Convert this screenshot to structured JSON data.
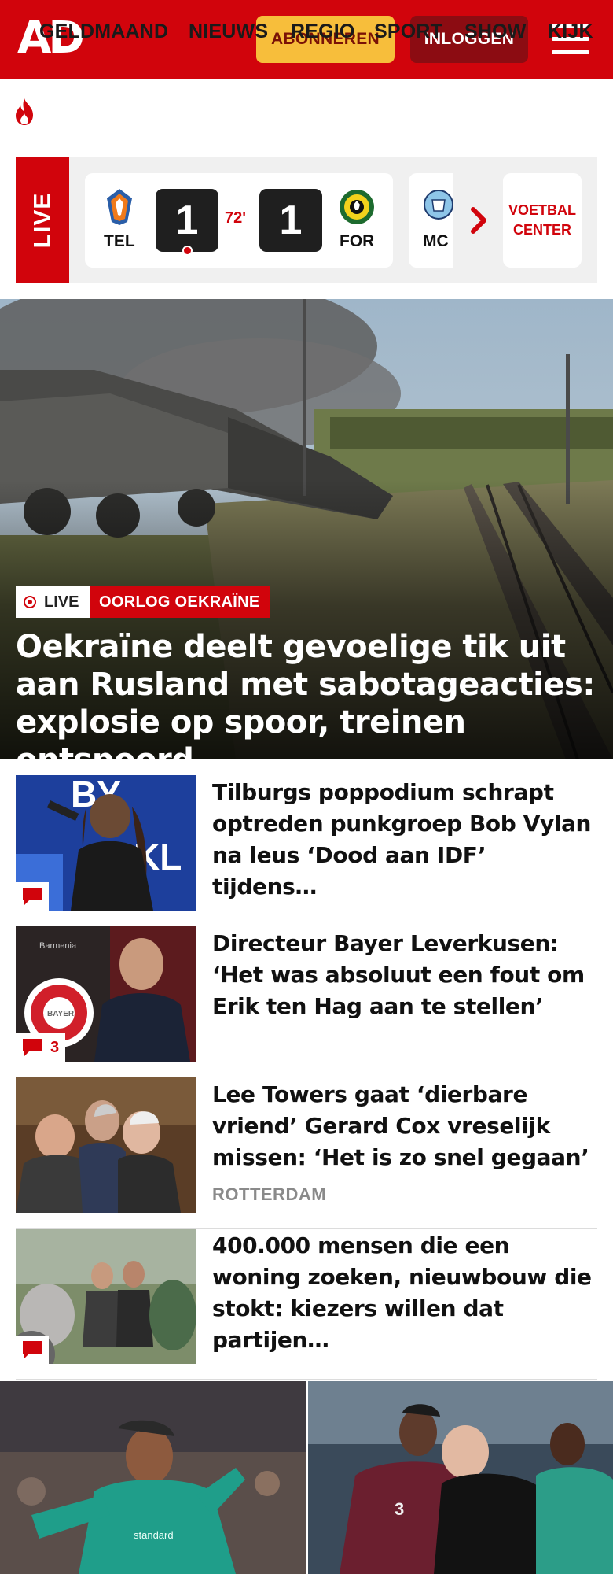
{
  "header": {
    "logo_text": "AD",
    "subscribe_label": "ABONNEREN",
    "login_label": "INLOGGEN",
    "menu_icon": "hamburger-menu-icon",
    "brand_color": "#d1040c",
    "subscribe_color": "#f7be3b"
  },
  "nav": {
    "items": [
      {
        "label": "GELDMAAND",
        "icon": "flame-icon"
      },
      {
        "label": "NIEUWS"
      },
      {
        "label": "REGIO"
      },
      {
        "label": "SPORT"
      },
      {
        "label": "SHOW"
      },
      {
        "label": "KIJK"
      }
    ]
  },
  "live_scores": {
    "live_label": "LIVE",
    "match": {
      "home": "TEL",
      "home_score": "1",
      "minute": "72'",
      "away_score": "1",
      "away": "FOR"
    },
    "next_match_home": "MC",
    "football_center_label": "VOETBAL CENTER"
  },
  "hero": {
    "live_tag": "LIVE",
    "topic_tag": "OORLOG OEKRAÏNE",
    "title": "Oekraïne deelt gevoelige tik uit aan Rusland met sabotageacties: explosie op spoor, treinen ontspoord"
  },
  "articles": [
    {
      "title": "Tilburgs poppodium schrapt optreden punkgroep Bob Vylan na leus ‘Dood aan IDF’ tijdens…",
      "comments": "",
      "meta": ""
    },
    {
      "title": "Directeur Bayer Leverkusen: ‘Het was absoluut een fout om Erik ten Hag aan te stellen’",
      "comments": "3",
      "meta": ""
    },
    {
      "title": "Lee Towers gaat ‘dierbare vriend’ Gerard Cox vreselijk missen: ‘Het is zo snel gegaan’",
      "comments": "",
      "meta": "ROTTERDAM"
    },
    {
      "title": "400.000 mensen die een woning zoeken, nieuwbouw die stokt: kiezers willen dat partijen…",
      "comments": "",
      "meta": ""
    }
  ]
}
